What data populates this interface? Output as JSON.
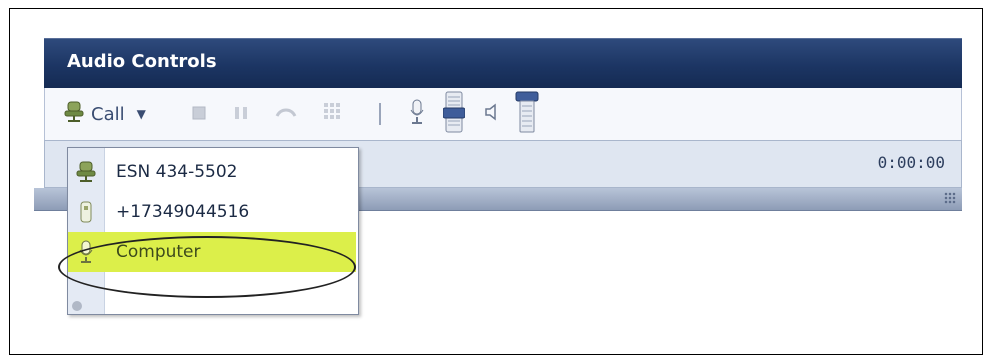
{
  "panel": {
    "title": "Audio Controls"
  },
  "toolbar": {
    "call_label": "Call",
    "icons": [
      "microphone-speaker-icon",
      "dropdown-caret-icon",
      "stop-icon",
      "pause-icon",
      "phone-link-icon",
      "keypad-icon",
      "separator",
      "microphone-icon",
      "volume-slider-icon",
      "speaker-icon",
      "connection-icon"
    ]
  },
  "status": {
    "timer": "0:00:00"
  },
  "dropdown": {
    "items": [
      {
        "label": "ESN 434-5502",
        "icon": "desk-phone-icon"
      },
      {
        "label": "+17349044516",
        "icon": "mobile-phone-icon"
      },
      {
        "label": "Computer",
        "icon": "microphone-icon",
        "selected": true
      }
    ]
  },
  "colors": {
    "titlebar": "#1c3563",
    "highlight": "#dcef4a"
  }
}
